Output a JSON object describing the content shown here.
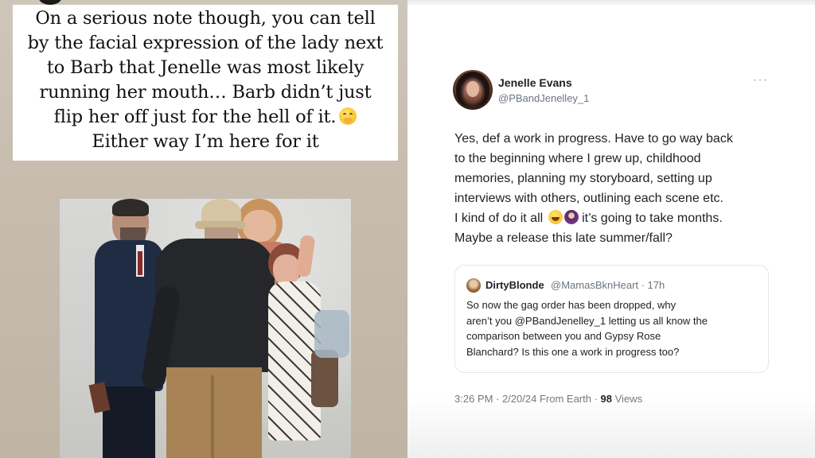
{
  "story": {
    "lines": [
      "On a serious note though, you can tell",
      "by the facial expression of the lady next",
      "to Barb that Jenelle was most likely",
      "running her mouth… Barb didn’t just",
      "flip her off just for the hell of it.",
      "Either way I’m here for it"
    ],
    "emoji_icon": "face-with-hand-over-mouth-icon"
  },
  "tweet": {
    "author_name": "Jenelle Evans",
    "author_handle": "@PBandJenelley_1",
    "more_icon": "···",
    "body_lines": [
      "Yes, def a work in progress. Have to go way back",
      "to the beginning where I grew up, childhood",
      "memories, planning my storyboard, setting up",
      "interviews with others, outlining each scene etc.",
      "I kind of do it all",
      "it’s going to take months.",
      "Maybe a release this late summer/fall?"
    ],
    "quote": {
      "author_name": "DirtyBlonde",
      "author_handle": "@MamasBknHeart · 17h",
      "lines": [
        "So now the gag order has been dropped, why",
        "aren’t you @PBandJenelley_1 letting us all know the",
        "comparison between you and Gypsy Rose",
        "Blanchard? Is this one a work in progress too?"
      ]
    },
    "meta": {
      "time_date": "3:26 PM · 2/20/24 From Earth ·",
      "views_count": "98",
      "views_label": "Views"
    }
  },
  "colors": {
    "story_bg": "#c7bcae",
    "text_dark": "#222222",
    "text_muted": "#6b7580"
  }
}
